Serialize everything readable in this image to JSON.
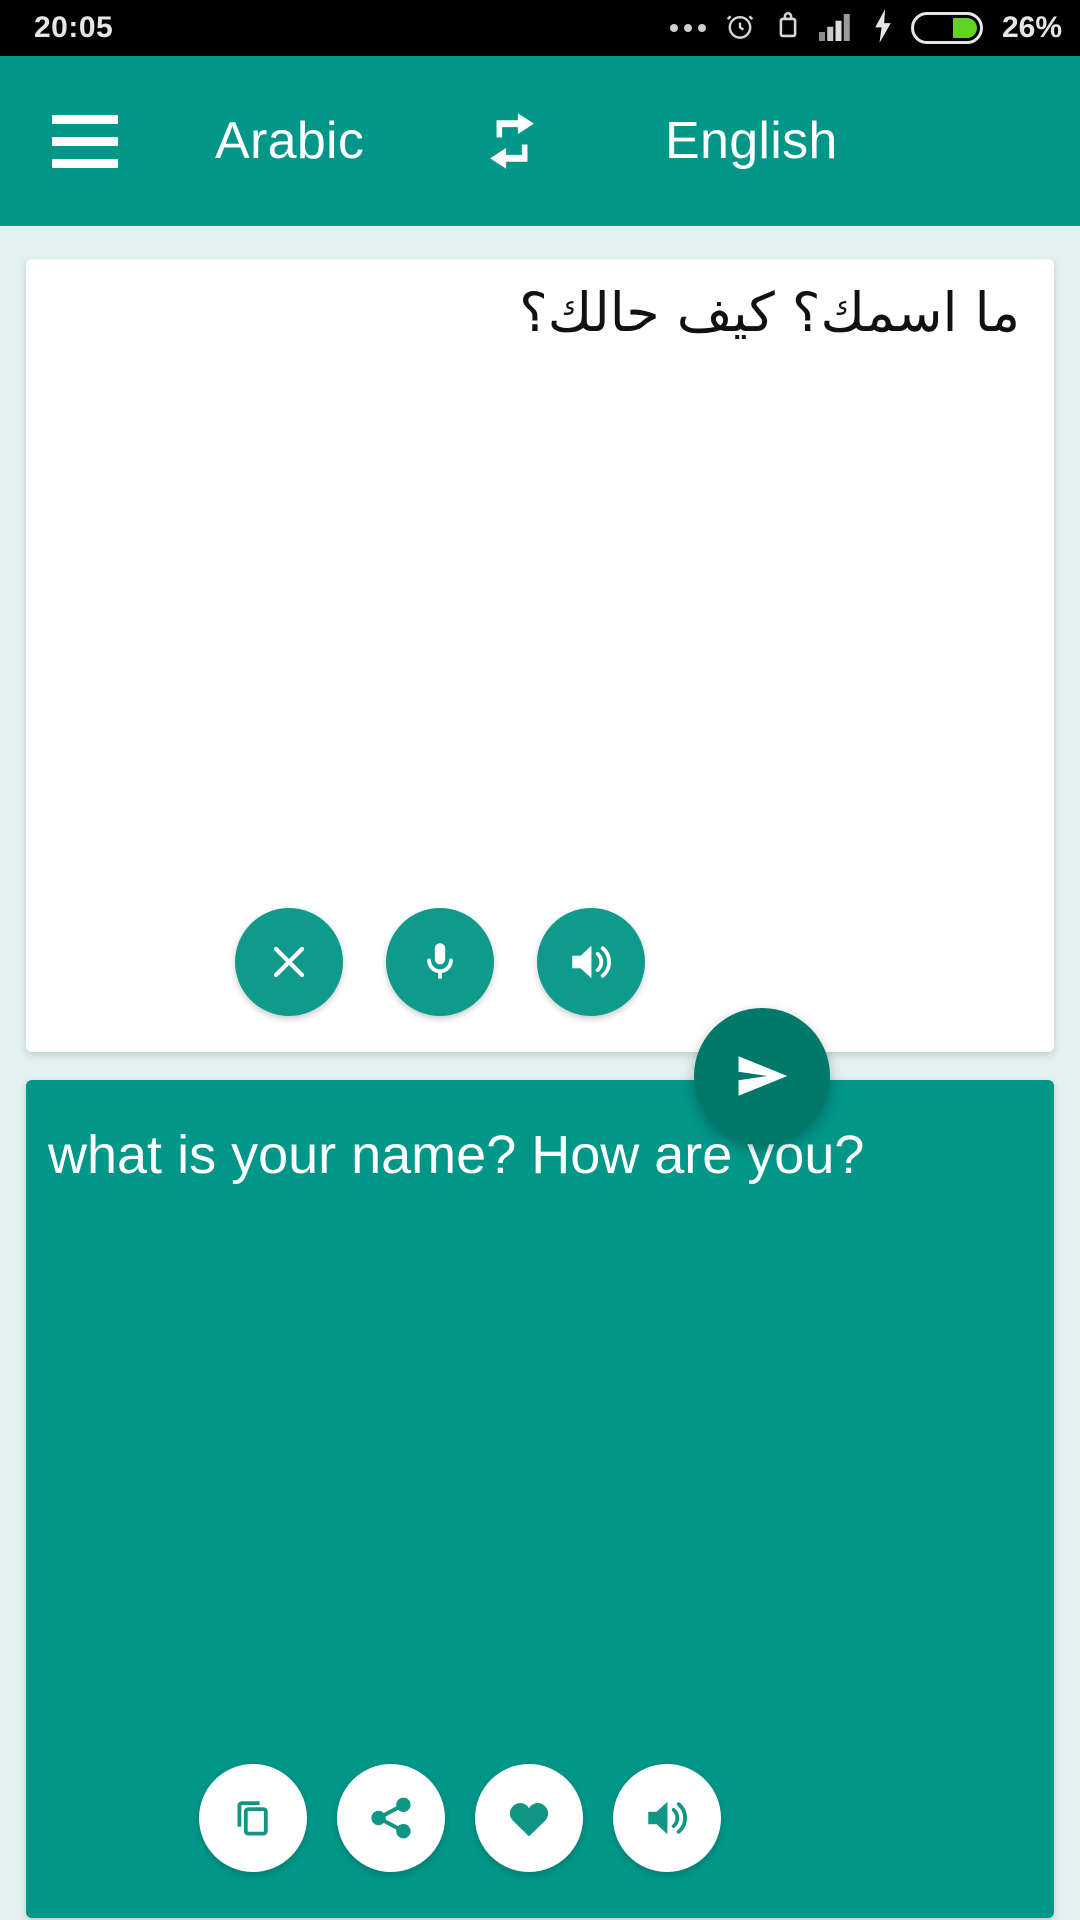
{
  "status_bar": {
    "time": "20:05",
    "icons": [
      "more-dots-icon",
      "alarm-icon",
      "vibrate-icon",
      "signal-icon",
      "charging-bolt-icon"
    ],
    "battery_percent": "26%",
    "battery_level": 26,
    "battery_color": "#62d321",
    "background": "#000000"
  },
  "app_bar": {
    "menu_icon": "hamburger-menu-icon",
    "source_language": "Arabic",
    "swap_icon": "swap-languages-icon",
    "target_language": "English",
    "background": "#009688"
  },
  "source_panel": {
    "text": "ما اسمك؟ كيف حالك؟",
    "background": "#ffffff",
    "actions": [
      {
        "name": "clear-button",
        "icon": "close-icon",
        "label": "Clear"
      },
      {
        "name": "voice-input-button",
        "icon": "microphone-icon",
        "label": "Voice input"
      },
      {
        "name": "speak-source-button",
        "icon": "speaker-icon",
        "label": "Speak"
      }
    ]
  },
  "send_button": {
    "icon": "send-icon",
    "label": "Translate",
    "color": "#00796b"
  },
  "target_panel": {
    "text": "what is your name? How are you?",
    "background": "#009688",
    "actions": [
      {
        "name": "copy-button",
        "icon": "copy-icon",
        "label": "Copy"
      },
      {
        "name": "share-button",
        "icon": "share-icon",
        "label": "Share"
      },
      {
        "name": "favorite-button",
        "icon": "heart-icon",
        "label": "Favorite"
      },
      {
        "name": "speak-target-button",
        "icon": "speaker-icon",
        "label": "Speak"
      }
    ]
  },
  "theme": {
    "primary": "#009688",
    "primary_dark": "#00796b",
    "page_background": "#e3f2f0",
    "card_background": "#ffffff"
  }
}
